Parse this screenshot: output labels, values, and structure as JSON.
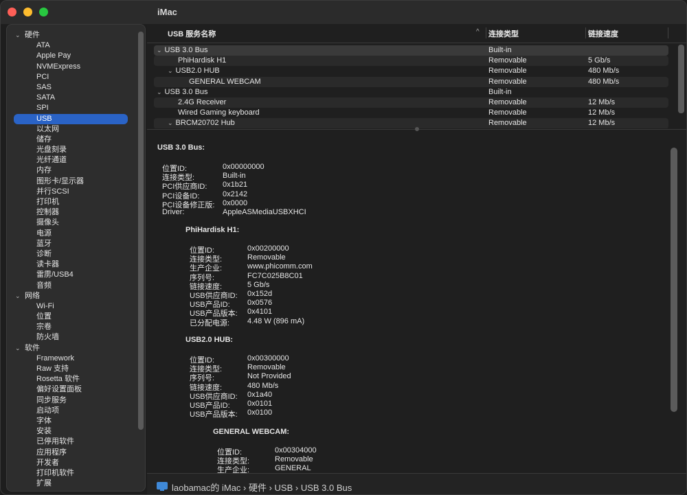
{
  "window": {
    "title": "iMac"
  },
  "sidebar": {
    "rows": [
      {
        "kind": "group",
        "label": "硬件"
      },
      {
        "kind": "item",
        "label": "ATA"
      },
      {
        "kind": "item",
        "label": "Apple Pay"
      },
      {
        "kind": "item",
        "label": "NVMExpress"
      },
      {
        "kind": "item",
        "label": "PCI"
      },
      {
        "kind": "item",
        "label": "SAS"
      },
      {
        "kind": "item",
        "label": "SATA"
      },
      {
        "kind": "item",
        "label": "SPI"
      },
      {
        "kind": "item",
        "label": "USB",
        "selected": true
      },
      {
        "kind": "item",
        "label": "以太网"
      },
      {
        "kind": "item",
        "label": "储存"
      },
      {
        "kind": "item",
        "label": "光盘刻录"
      },
      {
        "kind": "item",
        "label": "光纤通道"
      },
      {
        "kind": "item",
        "label": "内存"
      },
      {
        "kind": "item",
        "label": "图形卡/显示器"
      },
      {
        "kind": "item",
        "label": "并行SCSI"
      },
      {
        "kind": "item",
        "label": "打印机"
      },
      {
        "kind": "item",
        "label": "控制器"
      },
      {
        "kind": "item",
        "label": "摄像头"
      },
      {
        "kind": "item",
        "label": "电源"
      },
      {
        "kind": "item",
        "label": "蓝牙"
      },
      {
        "kind": "item",
        "label": "诊断"
      },
      {
        "kind": "item",
        "label": "读卡器"
      },
      {
        "kind": "item",
        "label": "雷雳/USB4"
      },
      {
        "kind": "item",
        "label": "音频"
      },
      {
        "kind": "group",
        "label": "网络"
      },
      {
        "kind": "item",
        "label": "Wi-Fi"
      },
      {
        "kind": "item",
        "label": "位置"
      },
      {
        "kind": "item",
        "label": "宗卷"
      },
      {
        "kind": "item",
        "label": "防火墙"
      },
      {
        "kind": "group",
        "label": "软件"
      },
      {
        "kind": "item",
        "label": "Framework"
      },
      {
        "kind": "item",
        "label": "Raw 支持"
      },
      {
        "kind": "item",
        "label": "Rosetta 软件"
      },
      {
        "kind": "item",
        "label": "偏好设置面板"
      },
      {
        "kind": "item",
        "label": "同步服务"
      },
      {
        "kind": "item",
        "label": "启动项"
      },
      {
        "kind": "item",
        "label": "字体"
      },
      {
        "kind": "item",
        "label": "安装"
      },
      {
        "kind": "item",
        "label": "已停用软件"
      },
      {
        "kind": "item",
        "label": "应用程序"
      },
      {
        "kind": "item",
        "label": "开发者"
      },
      {
        "kind": "item",
        "label": "打印机软件"
      },
      {
        "kind": "item",
        "label": "扩展"
      }
    ]
  },
  "table": {
    "headers": {
      "name": "USB 服务名称",
      "type": "连接类型",
      "speed": "链接速度"
    },
    "rows": [
      {
        "name": "USB 3.0 Bus",
        "type": "Built-in",
        "speed": "",
        "level": 0,
        "expander": true,
        "selected": true
      },
      {
        "name": "PhiHardisk H1",
        "type": "Removable",
        "speed": "5 Gb/s",
        "level": 1,
        "expander": false
      },
      {
        "name": "USB2.0 HUB",
        "type": "Removable",
        "speed": "480 Mb/s",
        "level": 1,
        "expander": true
      },
      {
        "name": "GENERAL WEBCAM",
        "type": "Removable",
        "speed": "480 Mb/s",
        "level": 2,
        "expander": false
      },
      {
        "name": "USB 3.0 Bus",
        "type": "Built-in",
        "speed": "",
        "level": 0,
        "expander": true
      },
      {
        "name": "2.4G Receiver",
        "type": "Removable",
        "speed": "12 Mb/s",
        "level": 1,
        "expander": false
      },
      {
        "name": "Wired Gaming keyboard",
        "type": "Removable",
        "speed": "12 Mb/s",
        "level": 1,
        "expander": false
      },
      {
        "name": "BRCM20702 Hub",
        "type": "Removable",
        "speed": "12 Mb/s",
        "level": 1,
        "expander": true
      }
    ]
  },
  "detail": {
    "bus": {
      "title": "USB 3.0 Bus:",
      "props": [
        [
          "位置ID:",
          "0x00000000"
        ],
        [
          "连接类型:",
          "Built-in"
        ],
        [
          "PCI供应商ID:",
          "0x1b21"
        ],
        [
          "PCI设备ID:",
          "0x2142"
        ],
        [
          "PCI设备修正版:",
          "0x0000"
        ],
        [
          "Driver:",
          "AppleASMediaUSBXHCI"
        ]
      ]
    },
    "disk": {
      "title": "PhiHardisk H1:",
      "props": [
        [
          "位置ID:",
          "0x00200000"
        ],
        [
          "连接类型:",
          "Removable"
        ],
        [
          "生产企业:",
          "www.phicomm.com"
        ],
        [
          "序列号:",
          "FC7C025B8C01"
        ],
        [
          "链接速度:",
          "5 Gb/s"
        ],
        [
          "USB供应商ID:",
          "0x152d"
        ],
        [
          "USB产品ID:",
          "0x0576"
        ],
        [
          "USB产品版本:",
          "0x4101"
        ],
        [
          "已分配电源:",
          "4.48 W (896 mA)"
        ]
      ]
    },
    "hub": {
      "title": "USB2.0 HUB:",
      "props": [
        [
          "位置ID:",
          "0x00300000"
        ],
        [
          "连接类型:",
          "Removable"
        ],
        [
          "序列号:",
          "Not Provided"
        ],
        [
          "链接速度:",
          "480 Mb/s"
        ],
        [
          "USB供应商ID:",
          "0x1a40"
        ],
        [
          "USB产品ID:",
          "0x0101"
        ],
        [
          "USB产品版本:",
          "0x0100"
        ]
      ]
    },
    "webcam": {
      "title": "GENERAL WEBCAM:",
      "props": [
        [
          "位置ID:",
          "0x00304000"
        ],
        [
          "连接类型:",
          "Removable"
        ],
        [
          "生产企业:",
          "GENERAL"
        ]
      ]
    }
  },
  "pathbar": {
    "text": "laobamac的 iMac › 硬件 › USB › USB 3.0 Bus",
    "icon": "computer-icon"
  }
}
